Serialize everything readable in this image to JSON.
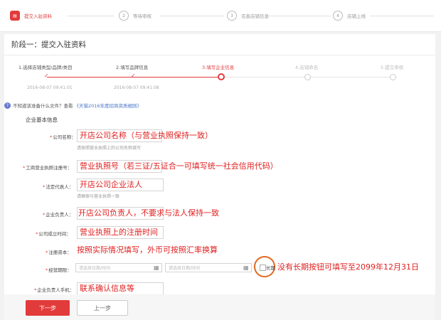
{
  "top_steps": [
    {
      "num": "1",
      "label": "提交入驻资料",
      "active": true
    },
    {
      "num": "2",
      "label": "等待审核",
      "active": false
    },
    {
      "num": "3",
      "label": "完善店铺信息",
      "active": false
    },
    {
      "num": "4",
      "label": "店铺上线",
      "active": false
    }
  ],
  "phase_title": "阶段一：提交入驻资料",
  "progress_steps": [
    {
      "label": "1.选择店铺类型/品牌/类目",
      "time": "2016-08-07 09:41:01",
      "state": "done"
    },
    {
      "label": "2.填写品牌信息",
      "time": "2016-08-07 09:41:08",
      "state": "done"
    },
    {
      "label": "3.填写企业信息",
      "time": "",
      "state": "current"
    },
    {
      "label": "4.店铺命名",
      "time": "",
      "state": "next"
    },
    {
      "label": "5.提交审核",
      "time": "",
      "state": "next"
    }
  ],
  "help": {
    "question": "不知道该准备什么文件？查看",
    "link": "《天猫2016年度招商资质细则》"
  },
  "section_title": "企业基本信息",
  "fields": {
    "company_name": {
      "label": "公司名称：",
      "annotation": "开店公司名称（与营业执照保持一致）",
      "hint": "请按照营业执照上的公司名称填写"
    },
    "license_no": {
      "label": "工商营业执照注册号：",
      "annotation": "营业执照号（若三证/五证合一可填写统一社会信用代码）"
    },
    "legal_rep": {
      "label": "法定代表人：",
      "annotation": "开店公司企业法人",
      "hint": "请确保与营业执照一致"
    },
    "contact": {
      "label": "企业负责人：",
      "annotation": "开店公司负责人，不要求与法人保持一致"
    },
    "founded": {
      "label": "公司成立时间：",
      "annotation": "营业执照上的注册时间"
    },
    "capital": {
      "label": "注册资本：",
      "annotation": "按照实际情况填写，外币可按照汇率换算"
    },
    "term": {
      "label": "经营期限：",
      "start_placeholder": "请选择日期/时间",
      "end_placeholder": "请选择日期/时间",
      "long_term_label": "长期",
      "annotation": "没有长期按钮可填写至2099年12月31日"
    },
    "phone": {
      "label": "企业负责人手机：",
      "annotation": "联系确认信息等"
    }
  },
  "buttons": {
    "next": "下一步",
    "prev": "上一步"
  },
  "colors": {
    "accent": "#e23b3b",
    "annotation": "#e02020",
    "circle": "#e2671d"
  }
}
